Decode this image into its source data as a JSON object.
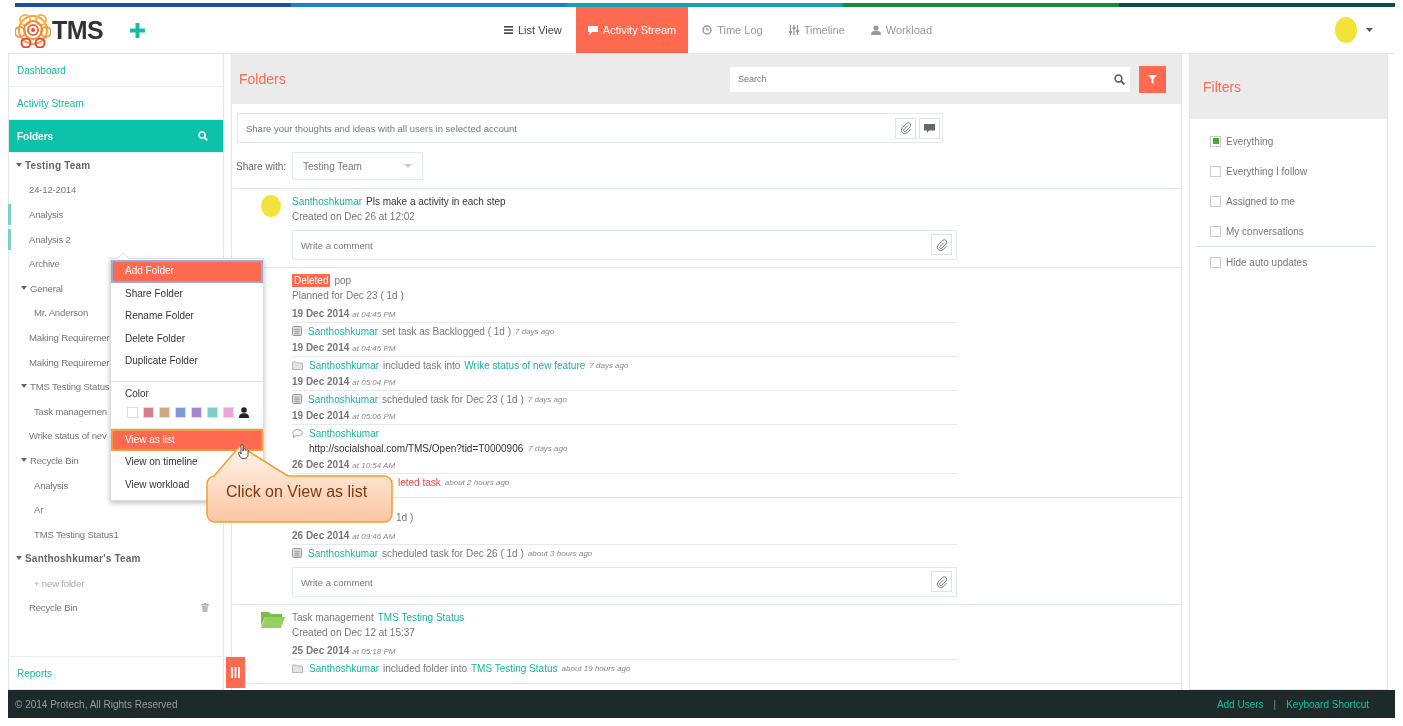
{
  "header": {
    "logo": "TMS"
  },
  "nav": [
    {
      "label": "List View",
      "selected": false
    },
    {
      "label": "Activity Stream",
      "selected": true
    },
    {
      "label": "Time Log",
      "selected": false
    },
    {
      "label": "Timeline",
      "selected": false
    },
    {
      "label": "Workload",
      "selected": false
    }
  ],
  "sidebar": {
    "links": [
      {
        "label": "Dashboard",
        "selected": false
      },
      {
        "label": "Activity Stream",
        "selected": false
      },
      {
        "label": "Folders",
        "selected": true
      }
    ],
    "tree": [
      {
        "label": "Testing Team",
        "kind": "team",
        "expanded": true,
        "children": [
          {
            "label": "24-12-2014",
            "kind": "folder"
          },
          {
            "label": "Analysis",
            "kind": "folder",
            "color": "#7fcdd0"
          },
          {
            "label": "Analysis 2",
            "kind": "folder",
            "color": "#7fcdd0"
          },
          {
            "label": "Archive",
            "kind": "folder"
          },
          {
            "label": "General",
            "kind": "folder",
            "expanded": true,
            "children": [
              {
                "label": "Mr. Anderson",
                "kind": "folder"
              }
            ]
          },
          {
            "label": "Making Requiremer",
            "kind": "folder"
          },
          {
            "label": "Making Requiremer",
            "kind": "folder"
          },
          {
            "label": "TMS Testing Status",
            "kind": "folder",
            "expanded": true,
            "children": [
              {
                "label": "Task managemen",
                "kind": "folder"
              }
            ]
          },
          {
            "label": "Wrike status of nev",
            "kind": "folder"
          },
          {
            "label": "Recycle Bin",
            "kind": "folder",
            "expanded": true,
            "children": [
              {
                "label": "Analysis",
                "kind": "folder"
              },
              {
                "label": "Ar",
                "kind": "folder"
              },
              {
                "label": "TMS Testing Status1",
                "kind": "folder"
              }
            ]
          }
        ]
      },
      {
        "label": "Santhoshkumar's Team",
        "kind": "team",
        "expanded": true,
        "children": [
          {
            "label": "+ new folder",
            "kind": "add"
          },
          {
            "label": "Recycle Bin",
            "kind": "bin"
          }
        ]
      }
    ],
    "footer_link": "Reports"
  },
  "context_menu": {
    "items": [
      {
        "label": "Add Folder",
        "highlighted": true
      },
      {
        "label": "Share Folder",
        "highlighted": false
      },
      {
        "label": "Rename Folder",
        "highlighted": false
      },
      {
        "label": "Delete Folder",
        "highlighted": false
      },
      {
        "label": "Duplicate Folder",
        "highlighted": false
      }
    ],
    "color_label": "Color",
    "swatches": [
      {
        "color": "#ffffff"
      },
      {
        "color": "#d4808a"
      },
      {
        "color": "#cfa882"
      },
      {
        "color": "#7f9ad4"
      },
      {
        "color": "#a585d0"
      },
      {
        "color": "#7fcccc"
      },
      {
        "color": "#eaa5d8"
      }
    ],
    "view_items": [
      {
        "label": "View as list",
        "highlighted": true
      },
      {
        "label": "View on timeline",
        "highlighted": false
      },
      {
        "label": "View workload",
        "highlighted": false
      }
    ]
  },
  "callout": "Click on View as list",
  "main": {
    "title": "Folders",
    "search": {
      "placeholder": "Search"
    },
    "composer": {
      "placeholder": "Share your thoughts and ideas with all users in selected account"
    },
    "share_with": {
      "label": "Share with:",
      "value": "Testing Team"
    },
    "posts": [
      {
        "kind": "user",
        "title": [
          {
            "kind": "user",
            "text": "Santhoshkumar"
          },
          {
            "kind": "plain",
            "text": "Pls make a activity in each step"
          }
        ],
        "subtitle": "Created on Dec 26 at 12:02",
        "comment_placeholder": "Write a comment"
      },
      {
        "kind": "task",
        "title": [
          {
            "kind": "badge",
            "text": "Deleted"
          },
          {
            "kind": "muted",
            "text": "pop"
          }
        ],
        "subtitle": "Planned for Dec 23 ( 1d )",
        "activities": [
          {
            "date": "19 Dec 2014",
            "time": "at 04:45 PM",
            "kind": "calendar",
            "message": [
              {
                "kind": "user",
                "text": "Santhoshkumar"
              },
              {
                "kind": "muted",
                "text": "set task as Backlogged ( 1d )"
              }
            ],
            "ago": "7 days ago"
          },
          {
            "date": "19 Dec 2014",
            "time": "at 04:45 PM",
            "kind": "folder",
            "message": [
              {
                "kind": "user",
                "text": "Santhoshkumar"
              },
              {
                "kind": "muted",
                "text": "included task into"
              },
              {
                "kind": "link",
                "text": "Wrike status of new feature"
              }
            ],
            "ago": "7 days ago"
          },
          {
            "date": "19 Dec 2014",
            "time": "at 05:04 PM",
            "kind": "calendar",
            "message": [
              {
                "kind": "user",
                "text": "Santhoshkumar"
              },
              {
                "kind": "muted",
                "text": "scheduled task for Dec 23 ( 1d )"
              }
            ],
            "ago": "7 days ago"
          },
          {
            "date": "19 Dec 2014",
            "time": "at 05:06 PM",
            "kind": "comment",
            "message": [
              {
                "kind": "user",
                "text": "Santhoshkumar"
              }
            ],
            "body": "http://socialshoal.com/TMS/Open?tid=T0000906",
            "ago": "7 days ago"
          },
          {
            "date": "26 Dec 2014",
            "time": "at 10:54 AM",
            "covered": true,
            "message": [
              {
                "kind": "deleted",
                "text": "leted task"
              }
            ],
            "ago": "about 2 hours ago"
          }
        ]
      },
      {
        "kind": "task",
        "covered": true,
        "subtitle": "1d )",
        "activities": [
          {
            "date": "26 Dec 2014",
            "time": "at 09:46 AM",
            "kind": "calendar",
            "message": [
              {
                "kind": "user",
                "text": "Santhoshkumar"
              },
              {
                "kind": "muted",
                "text": "scheduled task for Dec 26 ( 1d )"
              }
            ],
            "ago": "about 3 hours ago"
          }
        ],
        "comment_placeholder": "Write a comment"
      },
      {
        "kind": "folder",
        "title": [
          {
            "kind": "muted",
            "text": "Task management"
          },
          {
            "kind": "link",
            "text": "TMS Testing Status"
          }
        ],
        "subtitle": "Created on Dec 12 at 15:37",
        "activities": [
          {
            "date": "25 Dec 2014",
            "time": "at 05:18 PM",
            "kind": "folder",
            "message": [
              {
                "kind": "user",
                "text": "Santhoshkumar"
              },
              {
                "kind": "muted",
                "text": "included folder into"
              },
              {
                "kind": "link",
                "text": "TMS Testing Status"
              }
            ],
            "ago": "about 19 hours ago"
          }
        ]
      }
    ]
  },
  "filters": {
    "title": "Filters",
    "options": [
      {
        "label": "Everything",
        "checked": true,
        "kind": "filter"
      },
      {
        "label": "Everything I follow",
        "checked": false,
        "kind": "filter"
      },
      {
        "label": "Assigned to me",
        "checked": false,
        "kind": "filter"
      },
      {
        "label": "My conversations",
        "checked": false,
        "kind": "filter"
      },
      {
        "label": "Hide auto updates",
        "checked": false,
        "kind": "setting"
      }
    ]
  },
  "footer": {
    "copyright": "© 2014 Protech, All Rights Reserved",
    "links": [
      "Add Users",
      "Keyboard Shortcut"
    ],
    "separator": "|"
  }
}
